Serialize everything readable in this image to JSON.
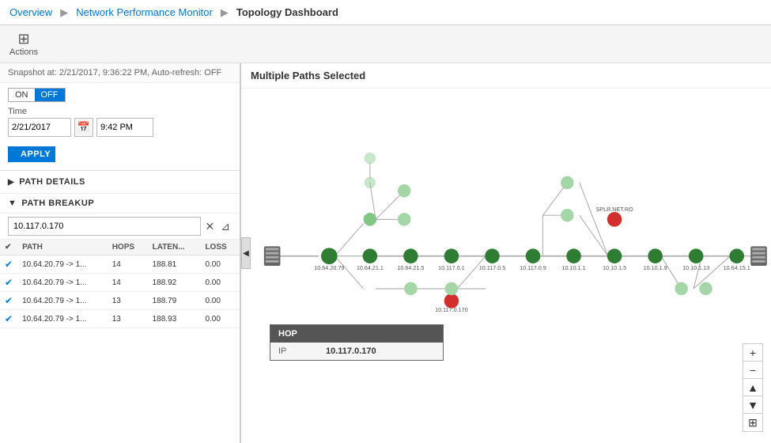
{
  "breadcrumb": {
    "overview": "Overview",
    "npm": "Network Performance Monitor",
    "page": "Topology Dashboard"
  },
  "toolbar": {
    "actions_label": "Actions",
    "actions_icon": "⊞"
  },
  "snapshot": {
    "text": "Snapshot at: 2/21/2017, 9:36:22 PM, Auto-refresh: OFF"
  },
  "toggle": {
    "on_label": "ON",
    "off_label": "OFF"
  },
  "time": {
    "label": "Time",
    "date_value": "2/21/2017",
    "time_value": "9:42 PM"
  },
  "apply_button": "APPLY",
  "sections": {
    "path_details": "PATH DETAILS",
    "path_breakup": "PATH BREAKUP"
  },
  "search": {
    "placeholder": "10.117.0.170"
  },
  "table": {
    "headers": [
      "",
      "PATH",
      "HOPS",
      "LATEN...",
      "LOSS"
    ],
    "rows": [
      {
        "checked": true,
        "path": "10.64.20.79 -> 1...",
        "hops": "14",
        "latency": "188.81",
        "loss": "0.00"
      },
      {
        "checked": true,
        "path": "10.64.20.79 -> 1...",
        "hops": "14",
        "latency": "188.92",
        "loss": "0.00"
      },
      {
        "checked": true,
        "path": "10.64.20.79 -> 1...",
        "hops": "13",
        "latency": "188.79",
        "loss": "0.00"
      },
      {
        "checked": true,
        "path": "10.64.20.79 -> 1...",
        "hops": "13",
        "latency": "188.93",
        "loss": "0.00"
      }
    ]
  },
  "topology": {
    "title": "Multiple Paths Selected",
    "hop_tooltip": {
      "header": "HOP",
      "label": "IP",
      "value": "10.117.0.170"
    }
  },
  "zoom_controls": {
    "plus": "+",
    "minus": "−",
    "up": "▲",
    "down": "▼",
    "grid": "⊞"
  },
  "colors": {
    "dark_green": "#2e7d32",
    "light_green": "#a5d6a7",
    "red": "#d32f2f",
    "accent": "#0078d7"
  }
}
